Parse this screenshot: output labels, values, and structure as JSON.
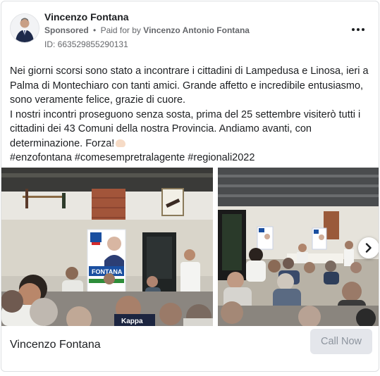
{
  "ad": {
    "page_name": "Vincenzo Fontana",
    "sponsored_label": "Sponsored",
    "separator": "•",
    "paid_for_prefix": "Paid for by",
    "payer_name": "Vincenzo Antonio Fontana",
    "ad_id": "ID: 663529855290131",
    "more_icon": "more-horizontal-icon"
  },
  "post": {
    "line1": "Nei giorni scorsi sono stato a incontrare i cittadini di Lampedusa e Linosa, ieri a Palma di Montechiaro con tanti amici. Grande affetto e incredibile entusiasmo, sono veramente felice, grazie di cuore.",
    "line2": "I nostri incontri proseguono senza sosta, prima del 25 settembre visiterò tutti i cittadini dei 43 Comuni della nostra Provincia. Andiamo avanti, con determinazione. Forza!",
    "hashtags": "#enzofontana #comesempretralagente #regionali2022"
  },
  "carousel": {
    "slide1_poster": "FONTANA",
    "slide1_shirt": "Kappa",
    "next_icon": "chevron-right-icon"
  },
  "footer": {
    "name": "Vincenzo Fontana",
    "cta_label": "Call Now"
  },
  "colors": {
    "text": "#1c1e21",
    "secondary": "#65676b",
    "cta_bg": "#e4e6eb",
    "cta_text": "#8d949e"
  }
}
